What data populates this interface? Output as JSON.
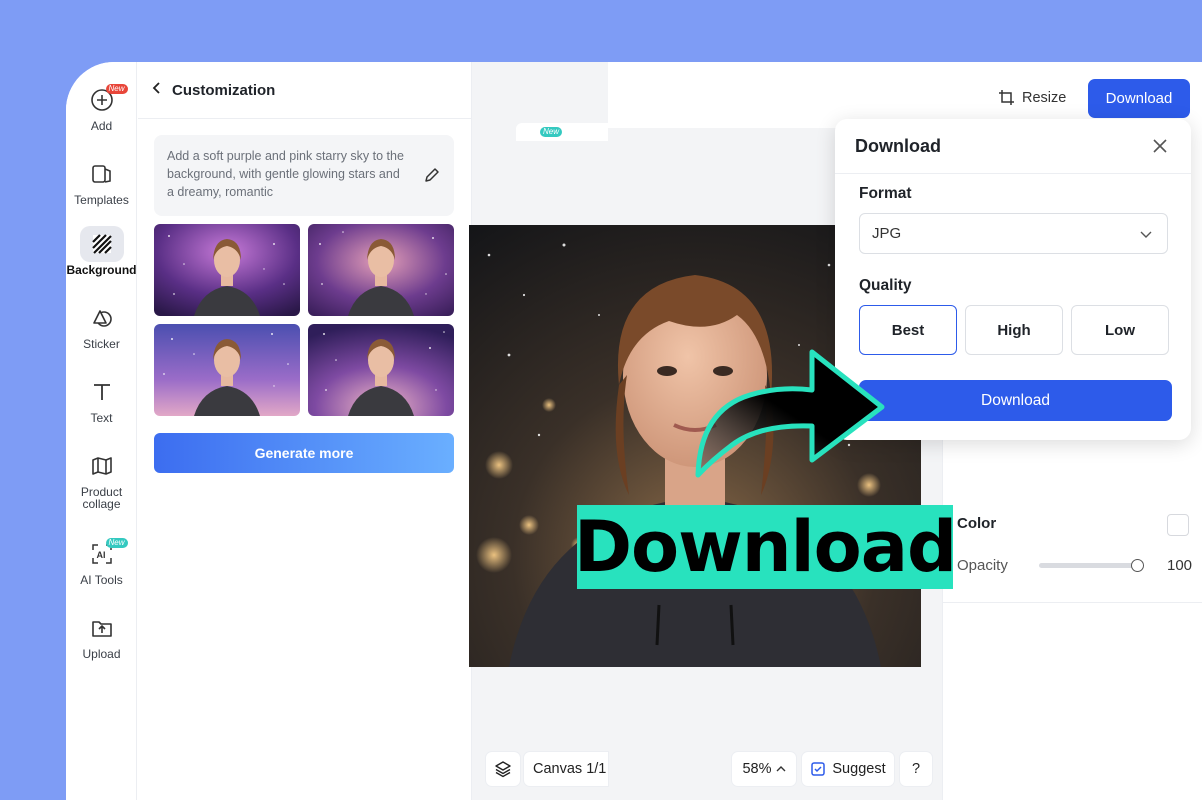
{
  "sidebar": {
    "items": [
      {
        "label": "Add",
        "icon": "plus-circle-icon",
        "badge": "New"
      },
      {
        "label": "Templates",
        "icon": "templates-icon"
      },
      {
        "label": "Background",
        "icon": "background-icon",
        "active": true
      },
      {
        "label": "Sticker",
        "icon": "sticker-icon"
      },
      {
        "label": "Text",
        "icon": "text-icon"
      },
      {
        "label": "Product",
        "label2": "collage",
        "icon": "collage-icon"
      },
      {
        "label": "AI Tools",
        "icon": "ai-tools-icon",
        "badge": "New"
      },
      {
        "label": "Upload",
        "icon": "upload-icon"
      }
    ]
  },
  "panel": {
    "title": "Customization",
    "prompt": "Add a soft purple and pink starry sky to the background, with gentle glowing stars and a dreamy, romantic",
    "generate_label": "Generate more"
  },
  "canvas": {
    "mini_badge": "New",
    "page_label": "Canvas 1/1",
    "zoom": "58%",
    "suggest_label": "Suggest",
    "help_label": "?"
  },
  "toolbar": {
    "resize_label": "Resize",
    "download_label": "Download"
  },
  "properties": {
    "color_label": "Color",
    "opacity_label": "Opacity",
    "opacity_value": "100"
  },
  "download_popup": {
    "title": "Download",
    "format_label": "Format",
    "format_value": "JPG",
    "quality_label": "Quality",
    "quality_options": [
      "Best",
      "High",
      "Low"
    ],
    "quality_selected": "Best",
    "download_label": "Download"
  },
  "overlay": {
    "big_text": "Download",
    "accent_color": "#28e2be"
  },
  "colors": {
    "page_bg": "#7e9cf5",
    "primary": "#2d5bea",
    "new_badge": "#e8463a"
  }
}
